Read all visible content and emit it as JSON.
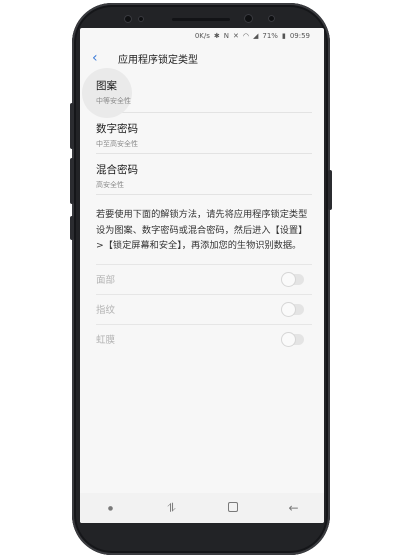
{
  "status_bar": {
    "speed": "0K/s",
    "battery": "71%",
    "time": "09:59",
    "icons": [
      "bluetooth-icon",
      "nfc-icon",
      "mute-icon",
      "wifi-icon",
      "signal-icon",
      "battery-icon"
    ]
  },
  "header": {
    "title": "应用程序锁定类型",
    "back_icon": "chevron-left-icon"
  },
  "lock_types": [
    {
      "title": "图案",
      "subtitle": "中等安全性"
    },
    {
      "title": "数字密码",
      "subtitle": "中至高安全性"
    },
    {
      "title": "混合密码",
      "subtitle": "高安全性"
    }
  ],
  "note": "若要使用下面的解锁方法，请先将应用程序锁定类型设为图案、数字密码或混合密码，然后进入【设置】>【锁定屏幕和安全】，再添加您的生物识别数据。",
  "biometrics": [
    {
      "label": "面部",
      "enabled": false
    },
    {
      "label": "指纹",
      "enabled": false
    },
    {
      "label": "虹膜",
      "enabled": false
    }
  ],
  "nav_bar": {
    "icons": [
      "dot-icon",
      "recents-icon",
      "home-icon",
      "back-icon"
    ]
  },
  "colors": {
    "accent": "#3c7bd8",
    "background": "#f7f7f7"
  }
}
